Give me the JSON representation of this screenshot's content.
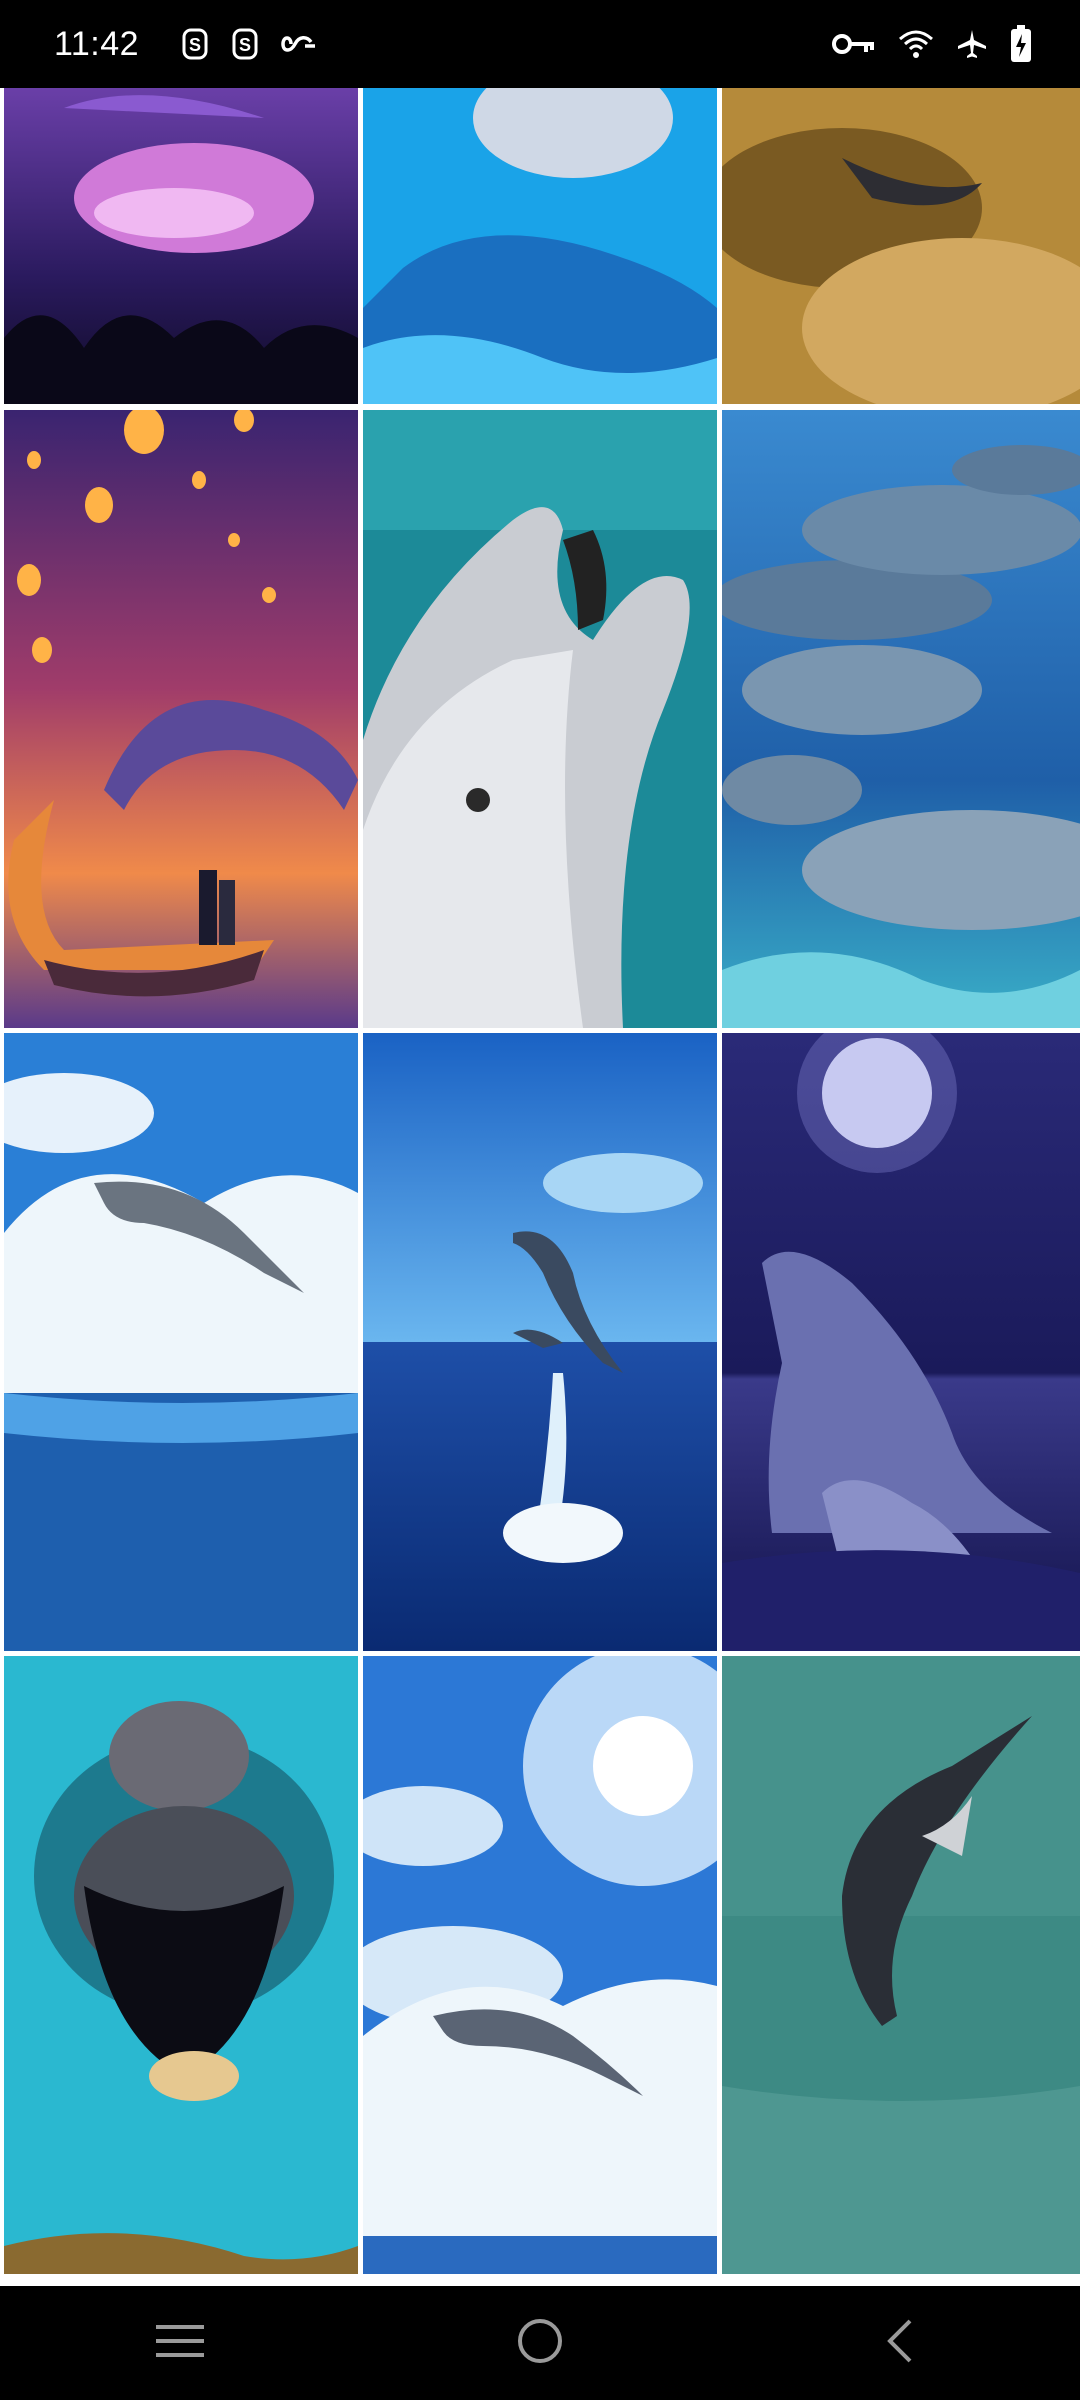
{
  "status_bar": {
    "time": "11:42",
    "left_icons": [
      "notification-s-icon",
      "notification-s-icon",
      "infinity-icon"
    ],
    "right_icons": [
      "vpn-key-icon",
      "wifi-icon",
      "airplane-mode-icon",
      "battery-charging-icon"
    ]
  },
  "gallery": {
    "columns": 3,
    "tiles": [
      {
        "name": "dolphin-purple-night"
      },
      {
        "name": "dolphin-blue-pool"
      },
      {
        "name": "dolphin-golden-clouds"
      },
      {
        "name": "dolphin-lanterns-couple"
      },
      {
        "name": "dolphin-closeup-teal"
      },
      {
        "name": "dolphin-pod-underwater"
      },
      {
        "name": "dolphin-wave-jump"
      },
      {
        "name": "dolphins-jumping-sky"
      },
      {
        "name": "dolphins-moonlight"
      },
      {
        "name": "dolphin-oil-painting"
      },
      {
        "name": "dolphin-wave-sunbeams"
      },
      {
        "name": "dolphin-jump-green-sea"
      }
    ]
  },
  "nav_bar": {
    "buttons": [
      "menu-icon",
      "home-icon",
      "back-icon"
    ]
  }
}
